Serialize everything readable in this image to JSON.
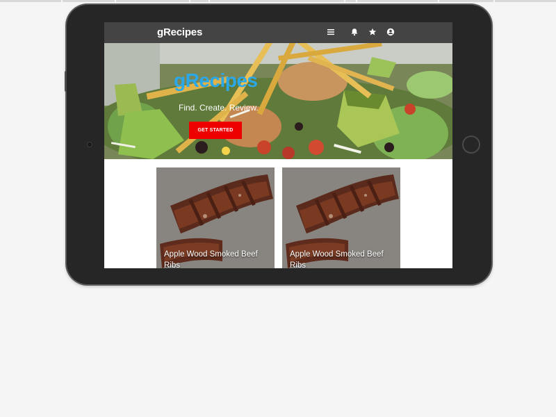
{
  "app": {
    "brand": "gRecipes",
    "nav_icons": [
      "menu-icon",
      "bell-icon",
      "star-icon",
      "account-circle-icon"
    ]
  },
  "hero": {
    "title": "gRecipes",
    "tagline": "Find. Create. Review.",
    "cta_label": "GET STARTED"
  },
  "recipes": [
    {
      "title": "Apple Wood Smoked Beef Ribs"
    },
    {
      "title": "Apple Wood Smoked Beef Ribs"
    }
  ],
  "colors": {
    "navbar": "#444444",
    "hero_title": "#2aa8e8",
    "cta": "#ee0000",
    "device_body": "#262626"
  }
}
